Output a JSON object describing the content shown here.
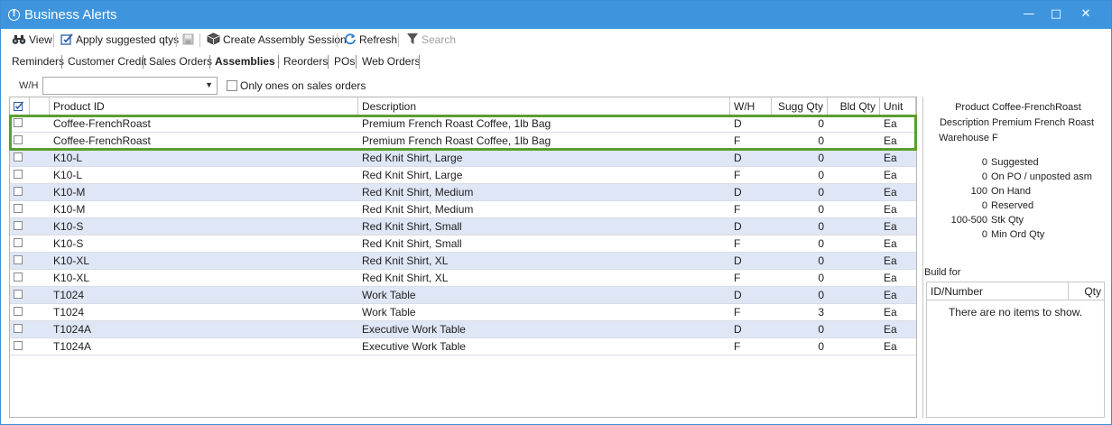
{
  "window": {
    "title": "Business Alerts",
    "title_icon": "alert-circle-icon",
    "controls": {
      "minimize": "—",
      "maximize": "□",
      "close": "✕"
    }
  },
  "toolbar": {
    "view": "View",
    "apply": "Apply suggested qtys",
    "create_session": "Create Assembly Session",
    "refresh": "Refresh",
    "search": "Search"
  },
  "tabs": [
    "Reminders",
    "Customer Credit",
    "Sales Orders",
    "Assemblies",
    "Reorders",
    "POs",
    "Web Orders"
  ],
  "active_tab": "Assemblies",
  "filter": {
    "wh_label": "W/H",
    "wh_value": "",
    "only_label": "Only ones on sales orders"
  },
  "grid": {
    "headers": {
      "product_id": "Product ID",
      "description": "Description",
      "wh": "W/H",
      "sugg": "Sugg Qty",
      "bld": "Bld Qty",
      "unit": "Unit"
    },
    "rows": [
      {
        "product": "Coffee-FrenchRoast",
        "description": "Premium French Roast Coffee, 1lb Bag",
        "wh": "D",
        "sugg": "0",
        "bld": "",
        "unit": "Ea"
      },
      {
        "product": "Coffee-FrenchRoast",
        "description": "Premium French Roast Coffee, 1lb Bag",
        "wh": "F",
        "sugg": "0",
        "bld": "",
        "unit": "Ea"
      },
      {
        "product": "K10-L",
        "description": "Red Knit Shirt, Large",
        "wh": "D",
        "sugg": "0",
        "bld": "",
        "unit": "Ea"
      },
      {
        "product": "K10-L",
        "description": "Red Knit Shirt, Large",
        "wh": "F",
        "sugg": "0",
        "bld": "",
        "unit": "Ea"
      },
      {
        "product": "K10-M",
        "description": "Red Knit Shirt, Medium",
        "wh": "D",
        "sugg": "0",
        "bld": "",
        "unit": "Ea"
      },
      {
        "product": "K10-M",
        "description": "Red Knit Shirt, Medium",
        "wh": "F",
        "sugg": "0",
        "bld": "",
        "unit": "Ea"
      },
      {
        "product": "K10-S",
        "description": "Red Knit Shirt, Small",
        "wh": "D",
        "sugg": "0",
        "bld": "",
        "unit": "Ea"
      },
      {
        "product": "K10-S",
        "description": "Red Knit Shirt, Small",
        "wh": "F",
        "sugg": "0",
        "bld": "",
        "unit": "Ea"
      },
      {
        "product": "K10-XL",
        "description": "Red Knit Shirt, XL",
        "wh": "D",
        "sugg": "0",
        "bld": "",
        "unit": "Ea"
      },
      {
        "product": "K10-XL",
        "description": "Red Knit Shirt, XL",
        "wh": "F",
        "sugg": "0",
        "bld": "",
        "unit": "Ea"
      },
      {
        "product": "T1024",
        "description": "Work Table",
        "wh": "D",
        "sugg": "0",
        "bld": "",
        "unit": "Ea"
      },
      {
        "product": "T1024",
        "description": "Work Table",
        "wh": "F",
        "sugg": "3",
        "bld": "",
        "unit": "Ea"
      },
      {
        "product": "T1024A",
        "description": "Executive Work Table",
        "wh": "D",
        "sugg": "0",
        "bld": "",
        "unit": "Ea"
      },
      {
        "product": "T1024A",
        "description": "Executive Work Table",
        "wh": "F",
        "sugg": "0",
        "bld": "",
        "unit": "Ea"
      }
    ]
  },
  "details": {
    "product_label": "Product",
    "product_value": "Coffee-FrenchRoast",
    "description_label": "Description",
    "description_value": "Premium French Roast",
    "warehouse_label": "Warehouse",
    "warehouse_value": "F",
    "stats": [
      {
        "num": "0",
        "label": "Suggested"
      },
      {
        "num": "0",
        "label": "On PO / unposted asm"
      },
      {
        "num": "100",
        "label": "On Hand"
      },
      {
        "num": "0",
        "label": "Reserved"
      },
      {
        "num": "100-500",
        "label": "Stk Qty"
      },
      {
        "num": "0",
        "label": "Min Ord Qty"
      }
    ],
    "build_for_label": "Build for",
    "build_for_headers": {
      "id": "ID/Number",
      "qty": "Qty"
    },
    "build_for_empty": "There are no items to show."
  },
  "colors": {
    "titlebar": "#3f95dd",
    "alt_row": "#dfe7f6",
    "highlight": "#5a9e2f"
  }
}
